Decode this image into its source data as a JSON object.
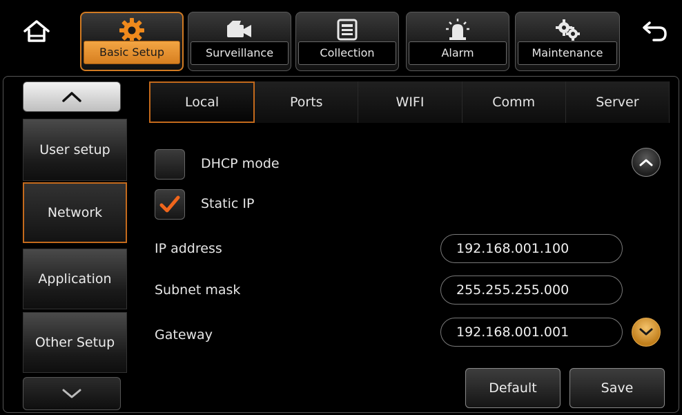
{
  "top_nav": {
    "home_icon": "home-icon",
    "back_icon": "back-arrow-icon",
    "tabs": [
      {
        "label": "Basic Setup",
        "icon": "gear-icon",
        "active": true
      },
      {
        "label": "Surveillance",
        "icon": "video-camera-icon",
        "active": false
      },
      {
        "label": "Collection",
        "icon": "document-icon",
        "active": false
      },
      {
        "label": "Alarm",
        "icon": "siren-icon",
        "active": false
      },
      {
        "label": "Maintenance",
        "icon": "gears-icon",
        "active": false
      }
    ]
  },
  "sidebar": {
    "items": [
      {
        "label": "User setup",
        "active": false
      },
      {
        "label": "Network",
        "active": true
      },
      {
        "label": "Application",
        "active": false
      },
      {
        "label": "Other Setup",
        "active": false
      }
    ]
  },
  "sub_tabs": [
    {
      "label": "Local",
      "active": true
    },
    {
      "label": "Ports",
      "active": false
    },
    {
      "label": "WIFI",
      "active": false
    },
    {
      "label": "Comm",
      "active": false
    },
    {
      "label": "Server",
      "active": false
    }
  ],
  "form": {
    "dhcp": {
      "label": "DHCP mode",
      "checked": false
    },
    "static_ip": {
      "label": "Static IP",
      "checked": true
    },
    "ip_address": {
      "label": "IP address",
      "value": "192.168.001.100"
    },
    "subnet_mask": {
      "label": "Subnet mask",
      "value": "255.255.255.000"
    },
    "gateway": {
      "label": "Gateway",
      "value": "192.168.001.001"
    }
  },
  "buttons": {
    "default_label": "Default",
    "save_label": "Save"
  },
  "colors": {
    "accent": "#d17a22",
    "scroll_down": "#e8a540"
  }
}
